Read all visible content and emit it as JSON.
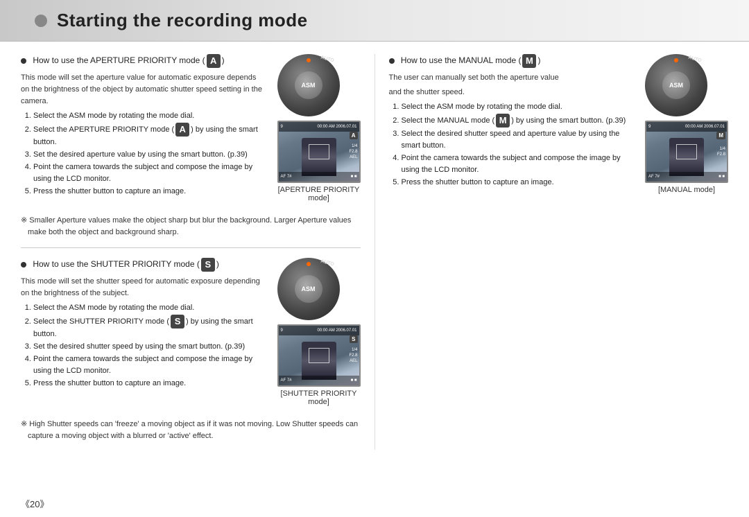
{
  "header": {
    "title": "Starting the recording mode"
  },
  "left_col": {
    "aperture_section": {
      "title": "How to use the APERTURE PRIORITY mode (",
      "badge": "A",
      "title_end": ")",
      "description": "This mode will set the aperture value for automatic exposure depends on the brightness of the object by automatic shutter speed setting in the camera.",
      "steps": [
        "Select the ASM mode by rotating the mode dial.",
        "Select the APERTURE PRIORITY mode ( ) by using the smart button.",
        "Set the desired aperture value by using the smart button. (p.39)",
        "Point the camera towards the subject and compose the image by using the LCD monitor.",
        "Press the shutter button to capture an image."
      ],
      "note": "Smaller Aperture values make the object sharp but blur the background. Larger Aperture values make both the object and background sharp.",
      "screen_caption_line1": "[APERTURE PRIORITY",
      "screen_caption_line2": "mode]"
    },
    "shutter_section": {
      "title": "How to use the SHUTTER PRIORITY mode (",
      "badge": "S",
      "title_end": ")",
      "description": "This mode will set the shutter speed for automatic exposure depending on the brightness of the subject.",
      "steps": [
        "Select the ASM mode by rotating the mode dial.",
        "Select the SHUTTER PRIORITY mode ( ) by using the smart button.",
        "Set the desired shutter speed by using the smart button. (p.39)",
        "Point the camera towards the subject and compose the image by using the LCD monitor.",
        "Press the shutter button to capture an image."
      ],
      "note": "High Shutter speeds can 'freeze' a moving object as if it was not moving. Low Shutter speeds can capture a moving object with a blurred or 'active' effect.",
      "screen_caption_line1": "[SHUTTER PRIORITY",
      "screen_caption_line2": "mode]"
    }
  },
  "right_col": {
    "manual_section": {
      "title": "How to use the MANUAL mode (",
      "badge": "M",
      "title_end": ")",
      "description_line1": "The user can manually set both the aperture value",
      "description_line2": "and the shutter speed.",
      "steps": [
        "Select the ASM mode by rotating the mode dial.",
        "Select the MANUAL mode ( ) by using the smart button. (p.39)",
        "Select the desired shutter speed and aperture value by using the smart button.",
        "Point the camera towards the subject and compose the image by using the LCD monitor.",
        "Press the shutter button to capture an image."
      ],
      "screen_caption_line1": "[MANUAL mode]"
    }
  },
  "page_number": "《20》",
  "lcd_top_text": "00:00 AM 2006.07.01",
  "lcd_bottom_text": "AF  7#",
  "lcd_f_value": "F2.8",
  "lcd_quarter": "1/4",
  "lcd_ael": "AEL"
}
